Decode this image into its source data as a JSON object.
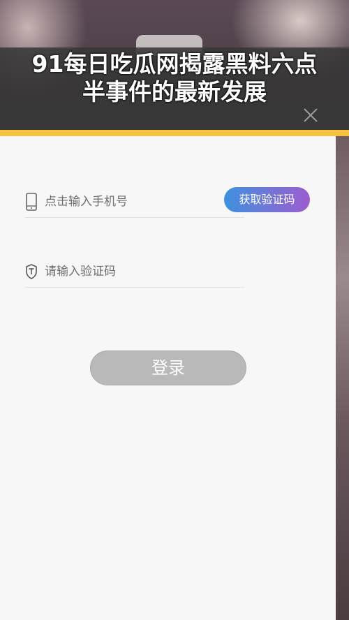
{
  "headline": {
    "line1": "91每日吃瓜网揭露黑料六点",
    "line2": "半事件的最新发展"
  },
  "login": {
    "phone_placeholder": "点击输入手机号",
    "code_placeholder": "请输入验证码",
    "get_code_label": "获取验证码",
    "submit_label": "登录"
  },
  "colors": {
    "accent_bar": "#f5c33f",
    "get_code_gradient_start": "#3e91e0",
    "get_code_gradient_end": "#9b5ccf",
    "login_button": "#b9b9b9"
  },
  "icons": {
    "close": "close-icon",
    "phone": "phone-icon",
    "shield": "shield-icon"
  }
}
